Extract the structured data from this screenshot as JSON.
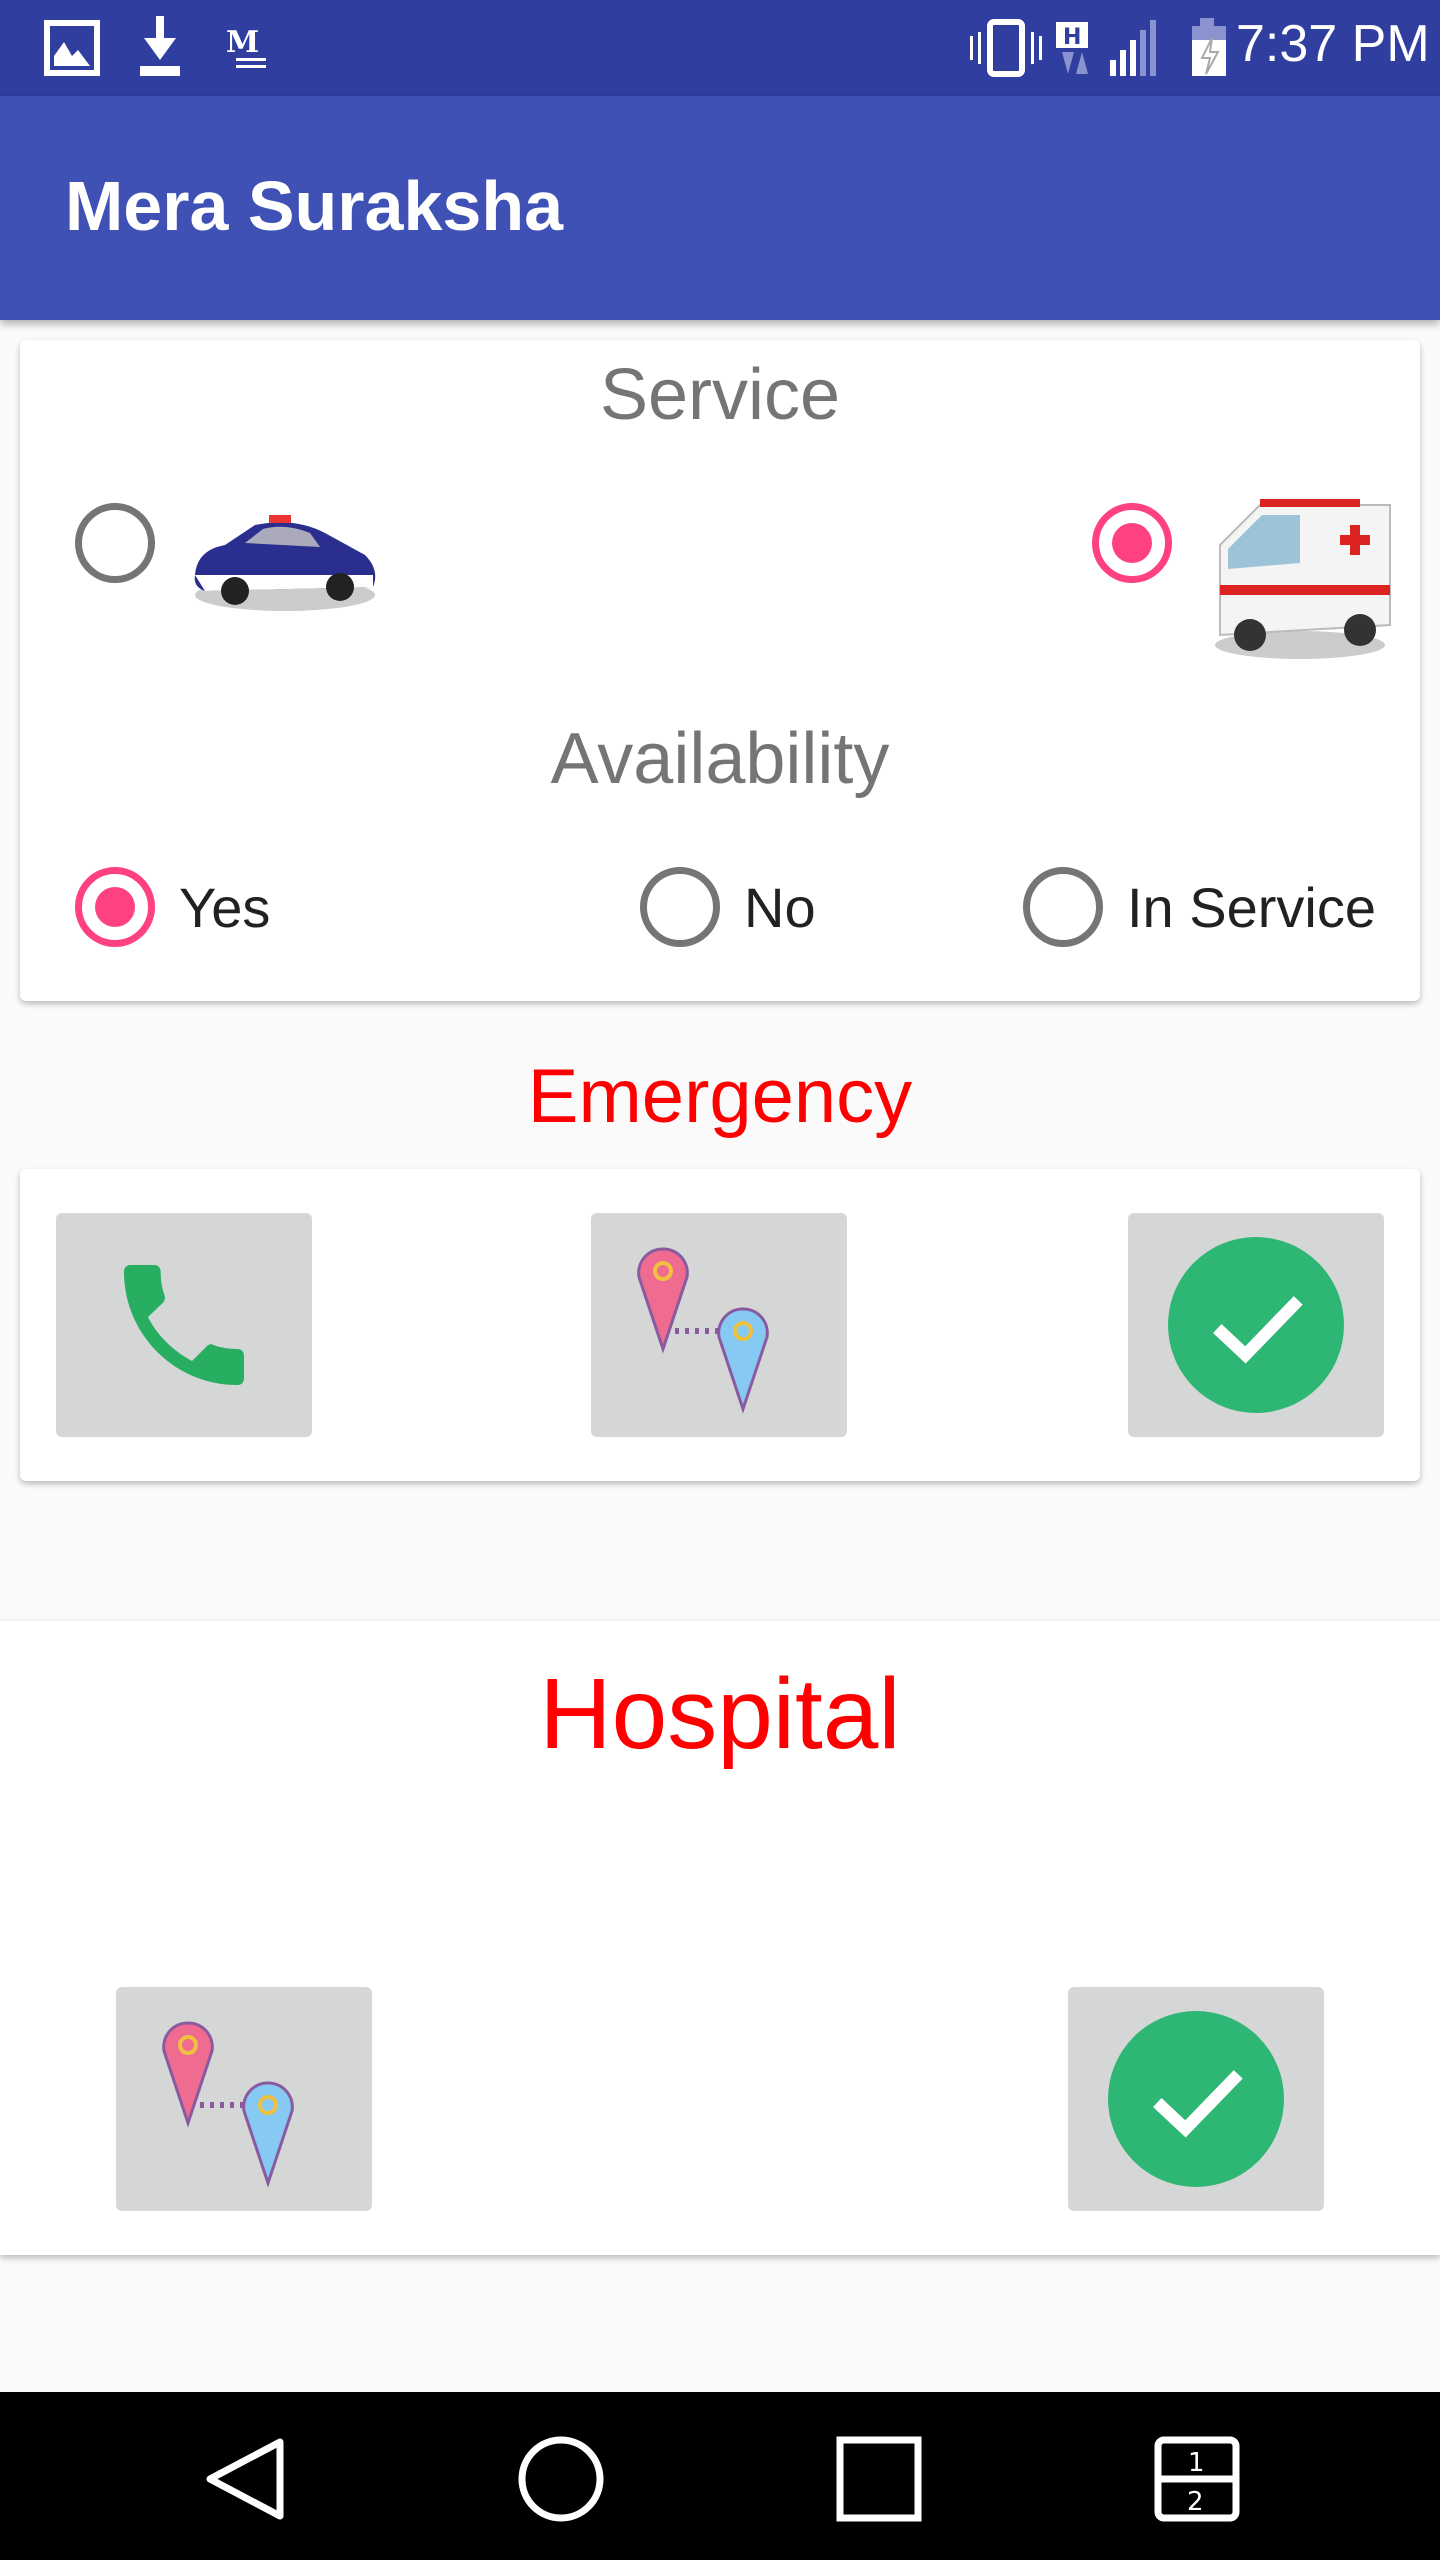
{
  "status_bar": {
    "time": "7:37 PM",
    "icons": [
      "image-icon",
      "download-icon",
      "gmail-icon",
      "vibrate-icon",
      "hspa-data-icon",
      "signal-icon",
      "battery-charging-icon"
    ]
  },
  "app_bar": {
    "title": "Mera Suraksha"
  },
  "service_card": {
    "service_heading": "Service",
    "service_options": [
      {
        "name": "police",
        "selected": false
      },
      {
        "name": "ambulance",
        "selected": true
      }
    ],
    "availability_heading": "Availability",
    "availability_options": [
      {
        "label": "Yes",
        "selected": true
      },
      {
        "label": "No",
        "selected": false
      },
      {
        "label": "In Service",
        "selected": false
      }
    ]
  },
  "emergency": {
    "heading": "Emergency",
    "buttons": [
      "call",
      "route",
      "confirm"
    ]
  },
  "hospital": {
    "heading": "Hospital",
    "buttons": [
      "route",
      "confirm"
    ]
  },
  "colors": {
    "primary": "#3F51B5",
    "primary_dark": "#303F9F",
    "accent": "#FF4081",
    "heading_red": "#FF0000",
    "green": "#2DB674"
  }
}
